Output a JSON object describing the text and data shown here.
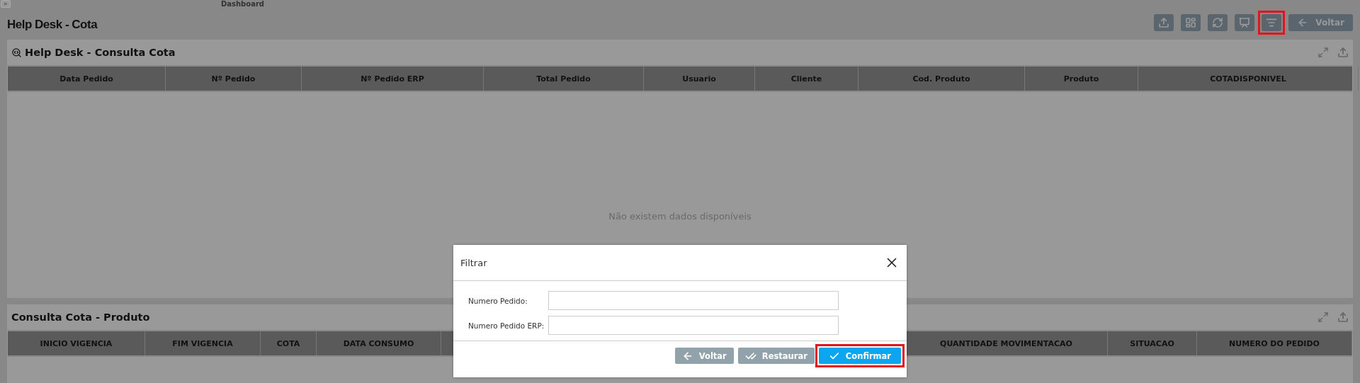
{
  "top_label": "Dashboard",
  "sidebar_toggle": "»",
  "page_title": "Help Desk - Cota",
  "toolbar": [
    {
      "kind": "upload",
      "highlighted": false
    },
    {
      "kind": "layout",
      "highlighted": false
    },
    {
      "kind": "refresh",
      "highlighted": false
    },
    {
      "kind": "chart",
      "highlighted": false
    },
    {
      "kind": "filter",
      "highlighted": true
    },
    {
      "kind": "back",
      "label": "Voltar",
      "highlighted": false
    }
  ],
  "panels": [
    {
      "title": "Help Desk - Consulta Cota",
      "has_icon": true,
      "columns": [
        "Data Pedido",
        "Nº Pedido",
        "Nº Pedido ERP",
        "Total Pedido",
        "Usuario",
        "Cliente",
        "Cod. Produto",
        "Produto",
        "COTADISPONIVEL"
      ],
      "empty_message": "Não existem dados disponíveis"
    },
    {
      "title": "Consulta Cota - Produto",
      "has_icon": false,
      "columns": [
        "INICIO VIGENCIA",
        "FIM VIGENCIA",
        "COTA",
        "DATA CONSUMO"
      ],
      "columns_after_dialog": [
        "QUANTIDADE MOVIMENTACAO",
        "SITUACAO",
        "NUMERO DO PEDIDO"
      ]
    }
  ],
  "dialog": {
    "title": "Filtrar",
    "fields": [
      {
        "label": "Numero Pedido:"
      },
      {
        "label": "Numero Pedido ERP:"
      }
    ],
    "buttons": [
      {
        "kind": "back",
        "label": "Voltar",
        "highlighted": false
      },
      {
        "kind": "restore",
        "label": "Restaurar",
        "highlighted": false
      },
      {
        "kind": "confirm",
        "label": "Confirmar",
        "highlighted": true
      }
    ]
  }
}
